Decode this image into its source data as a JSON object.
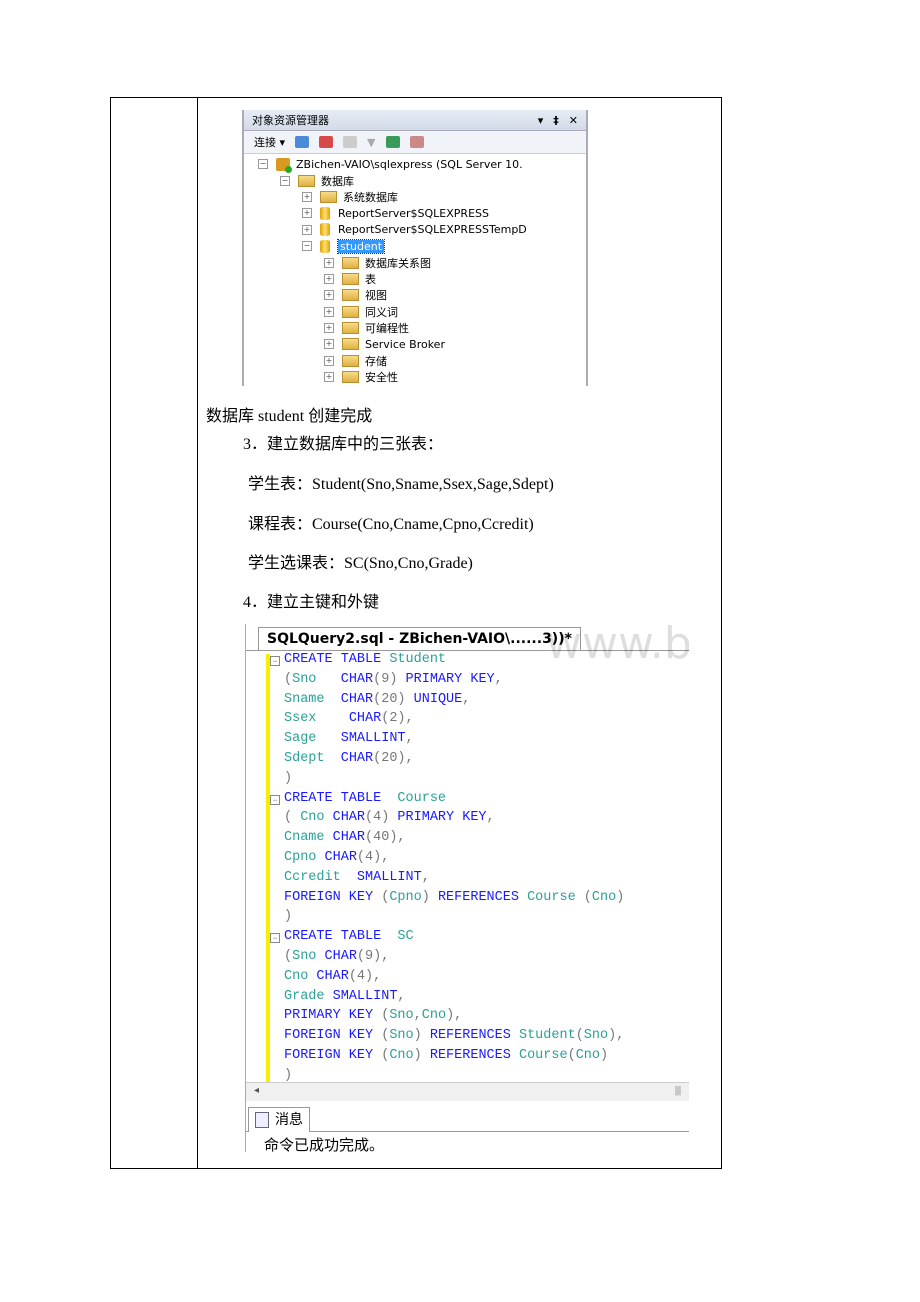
{
  "object_explorer": {
    "title": "对象资源管理器",
    "connect_label": "连接",
    "tree": [
      {
        "level": 0,
        "type": "server",
        "label": "ZBichen-VAIO\\sqlexpress (SQL Server 10.",
        "expanded": true
      },
      {
        "level": 1,
        "type": "folder",
        "label": "数据库",
        "expanded": true
      },
      {
        "level": 2,
        "type": "folder",
        "label": "系统数据库",
        "expanded": false
      },
      {
        "level": 2,
        "type": "db",
        "label": "ReportServer$SQLEXPRESS",
        "expanded": false
      },
      {
        "level": 2,
        "type": "db",
        "label": "ReportServer$SQLEXPRESSTempD",
        "expanded": false
      },
      {
        "level": 2,
        "type": "db",
        "label": "student",
        "expanded": true,
        "selected": true
      },
      {
        "level": 3,
        "type": "folder",
        "label": "数据库关系图",
        "expanded": false
      },
      {
        "level": 3,
        "type": "folder",
        "label": "表",
        "expanded": false
      },
      {
        "level": 3,
        "type": "folder",
        "label": "视图",
        "expanded": false
      },
      {
        "level": 3,
        "type": "folder",
        "label": "同义词",
        "expanded": false
      },
      {
        "level": 3,
        "type": "folder",
        "label": "可编程性",
        "expanded": false
      },
      {
        "level": 3,
        "type": "folder",
        "label": "Service Broker",
        "expanded": false
      },
      {
        "level": 3,
        "type": "folder",
        "label": "存储",
        "expanded": false
      },
      {
        "level": 3,
        "type": "folder",
        "label": "安全性",
        "expanded": false
      }
    ]
  },
  "doc": {
    "line1": "数据库 student 创建完成",
    "line2": "3．建立数据库中的三张表：",
    "line3": "学生表：Student(Sno,Sname,Ssex,Sage,Sdept)",
    "line4": "课程表：Course(Cno,Cname,Cpno,Ccredit)",
    "line5": "学生选课表：SC(Sno,Cno,Grade)",
    "line6": "4．建立主键和外键"
  },
  "query": {
    "tab_title": "SQLQuery2.sql - ZBichen-VAIO\\......3))*",
    "watermark": "www.bdocx.com",
    "lines": [
      [
        [
          "k",
          "CREATE TABLE "
        ],
        [
          "i",
          "Student"
        ]
      ],
      [
        [
          "p",
          "("
        ],
        [
          "i",
          "Sno   "
        ],
        [
          "k",
          "CHAR"
        ],
        [
          "p",
          "(9) "
        ],
        [
          "k",
          "PRIMARY KEY"
        ],
        [
          "p",
          ","
        ]
      ],
      [
        [
          "i",
          "Sname  "
        ],
        [
          "k",
          "CHAR"
        ],
        [
          "p",
          "(20) "
        ],
        [
          "k",
          "UNIQUE"
        ],
        [
          "p",
          ","
        ]
      ],
      [
        [
          "i",
          "Ssex    "
        ],
        [
          "k",
          "CHAR"
        ],
        [
          "p",
          "(2),"
        ]
      ],
      [
        [
          "i",
          "Sage   "
        ],
        [
          "k",
          "SMALLINT"
        ],
        [
          "p",
          ","
        ]
      ],
      [
        [
          "i",
          "Sdept  "
        ],
        [
          "k",
          "CHAR"
        ],
        [
          "p",
          "(20),"
        ]
      ],
      [
        [
          "p",
          ")"
        ]
      ],
      [
        [
          "k",
          "CREATE TABLE  "
        ],
        [
          "i",
          "Course"
        ]
      ],
      [
        [
          "p",
          "( "
        ],
        [
          "i",
          "Cno "
        ],
        [
          "k",
          "CHAR"
        ],
        [
          "p",
          "(4) "
        ],
        [
          "k",
          "PRIMARY KEY"
        ],
        [
          "p",
          ","
        ]
      ],
      [
        [
          "i",
          "Cname "
        ],
        [
          "k",
          "CHAR"
        ],
        [
          "p",
          "(40),"
        ]
      ],
      [
        [
          "i",
          "Cpno "
        ],
        [
          "k",
          "CHAR"
        ],
        [
          "p",
          "(4),"
        ]
      ],
      [
        [
          "i",
          "Ccredit  "
        ],
        [
          "k",
          "SMALLINT"
        ],
        [
          "p",
          ","
        ]
      ],
      [
        [
          "k",
          "FOREIGN KEY "
        ],
        [
          "p",
          "("
        ],
        [
          "i",
          "Cpno"
        ],
        [
          "p",
          ") "
        ],
        [
          "k",
          "REFERENCES "
        ],
        [
          "i",
          "Course "
        ],
        [
          "p",
          "("
        ],
        [
          "i",
          "Cno"
        ],
        [
          "p",
          ")"
        ]
      ],
      [
        [
          "p",
          ")"
        ]
      ],
      [
        [
          "k",
          "CREATE TABLE  "
        ],
        [
          "i",
          "SC"
        ]
      ],
      [
        [
          "p",
          "("
        ],
        [
          "i",
          "Sno "
        ],
        [
          "k",
          "CHAR"
        ],
        [
          "p",
          "(9),"
        ]
      ],
      [
        [
          "i",
          "Cno "
        ],
        [
          "k",
          "CHAR"
        ],
        [
          "p",
          "(4),"
        ]
      ],
      [
        [
          "i",
          "Grade "
        ],
        [
          "k",
          "SMALLINT"
        ],
        [
          "p",
          ","
        ]
      ],
      [
        [
          "k",
          "PRIMARY KEY "
        ],
        [
          "p",
          "("
        ],
        [
          "i",
          "Sno"
        ],
        [
          "p",
          ","
        ],
        [
          "i",
          "Cno"
        ],
        [
          "p",
          "),"
        ]
      ],
      [
        [
          "k",
          "FOREIGN KEY "
        ],
        [
          "p",
          "("
        ],
        [
          "i",
          "Sno"
        ],
        [
          "p",
          ") "
        ],
        [
          "k",
          "REFERENCES "
        ],
        [
          "i",
          "Student"
        ],
        [
          "p",
          "("
        ],
        [
          "i",
          "Sno"
        ],
        [
          "p",
          "),"
        ]
      ],
      [
        [
          "k",
          "FOREIGN KEY "
        ],
        [
          "p",
          "("
        ],
        [
          "i",
          "Cno"
        ],
        [
          "p",
          ") "
        ],
        [
          "k",
          "REFERENCES "
        ],
        [
          "i",
          "Course"
        ],
        [
          "p",
          "("
        ],
        [
          "i",
          "Cno"
        ],
        [
          "p",
          ")"
        ]
      ],
      [
        [
          "p",
          ")"
        ]
      ]
    ],
    "messages_tab": "消息",
    "message": "命令已成功完成。"
  },
  "colors": {
    "keyword": "#1a1aff",
    "identifier": "#2aa198",
    "punct": "#777777",
    "selection": "#3399ff",
    "change_bar": "#f4f000"
  }
}
